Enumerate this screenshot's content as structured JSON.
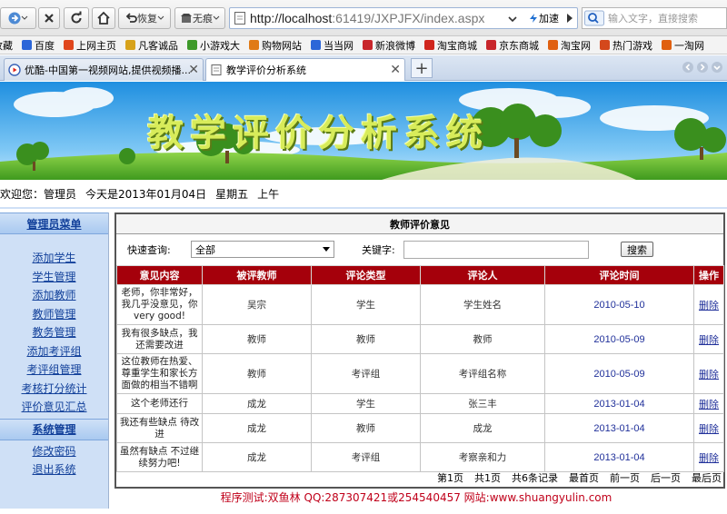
{
  "browser": {
    "back_label": "",
    "restore_label": "恢复",
    "mark_label": "无痕",
    "url_host": "http://localhost",
    "url_path": ":61419/JXPJFX/index.aspx",
    "accelerate_label": "加速",
    "search_placeholder": "输入文字，直接搜索",
    "favorites": [
      "收藏",
      "百度",
      "上网主页",
      "凡客诚品",
      "小游戏大",
      "购物网站",
      "当当网",
      "新浪微博",
      "淘宝商城",
      "京东商城",
      "淘宝网",
      "热门游戏",
      "一淘网"
    ],
    "tabs": [
      {
        "label": "优酷-中国第一视频网站,提供视频播..."
      },
      {
        "label": "教学评价分析系统"
      }
    ]
  },
  "banner": {
    "title": "教学评价分析系统"
  },
  "welcome": {
    "greeting": "欢迎您：管理员",
    "today": "今天是2013年01月04日",
    "weekday": "星期五",
    "period": "上午"
  },
  "sidebar": {
    "admin_head": "管理员菜单",
    "admin_items": [
      "添加学生",
      "学生管理",
      "添加教师",
      "教师管理",
      "教务管理",
      "添加考评组",
      "考评组管理",
      "考核打分统计",
      "评价意见汇总"
    ],
    "system_head": "系统管理",
    "system_items": [
      "修改密码",
      "退出系统"
    ]
  },
  "panel": {
    "title": "教师评价意见",
    "quick_label": "快速查询:",
    "quick_value": "全部",
    "keyword_label": "关键字:",
    "keyword_value": "",
    "search_button": "搜索"
  },
  "table": {
    "headers": [
      "意见内容",
      "被评教师",
      "评论类型",
      "评论人",
      "评论时间",
      "操作"
    ],
    "rows": [
      {
        "content": "老师，你非常好，我几乎没意见，你very good!",
        "teacher": "吴宗",
        "type": "学生",
        "reviewer": "学生姓名",
        "date": "2010-05-10",
        "action": "删除"
      },
      {
        "content": "我有很多缺点，我还需要改进",
        "teacher": "教师",
        "type": "教师",
        "reviewer": "教师",
        "date": "2010-05-09",
        "action": "删除"
      },
      {
        "content": "这位教师在热爱、尊重学生和家长方面做的相当不错啊",
        "teacher": "教师",
        "type": "考评组",
        "reviewer": "考评组名称",
        "date": "2010-05-09",
        "action": "删除"
      },
      {
        "content": "这个老师还行",
        "teacher": "成龙",
        "type": "学生",
        "reviewer": "张三丰",
        "date": "2013-01-04",
        "action": "删除"
      },
      {
        "content": "我还有些缺点 待改进",
        "teacher": "成龙",
        "type": "教师",
        "reviewer": "成龙",
        "date": "2013-01-04",
        "action": "删除"
      },
      {
        "content": "虽然有缺点 不过继续努力吧!",
        "teacher": "成龙",
        "type": "考评组",
        "reviewer": "考察亲和力",
        "date": "2013-01-04",
        "action": "删除"
      }
    ]
  },
  "pager": {
    "page": "第1页",
    "total_pages": "共1页",
    "total_records": "共6条记录",
    "first": "最首页",
    "prev": "前一页",
    "next": "后一页",
    "last": "最后页"
  },
  "footer": {
    "text": "程序测试:双鱼林 QQ:287307421或254540457 网站:www.shuangyulin.com"
  },
  "colors": {
    "table_header": "#a5000b",
    "sidebar_bg": "#cfe0f6",
    "footer_text": "#c0001a",
    "link": "#12409a"
  }
}
